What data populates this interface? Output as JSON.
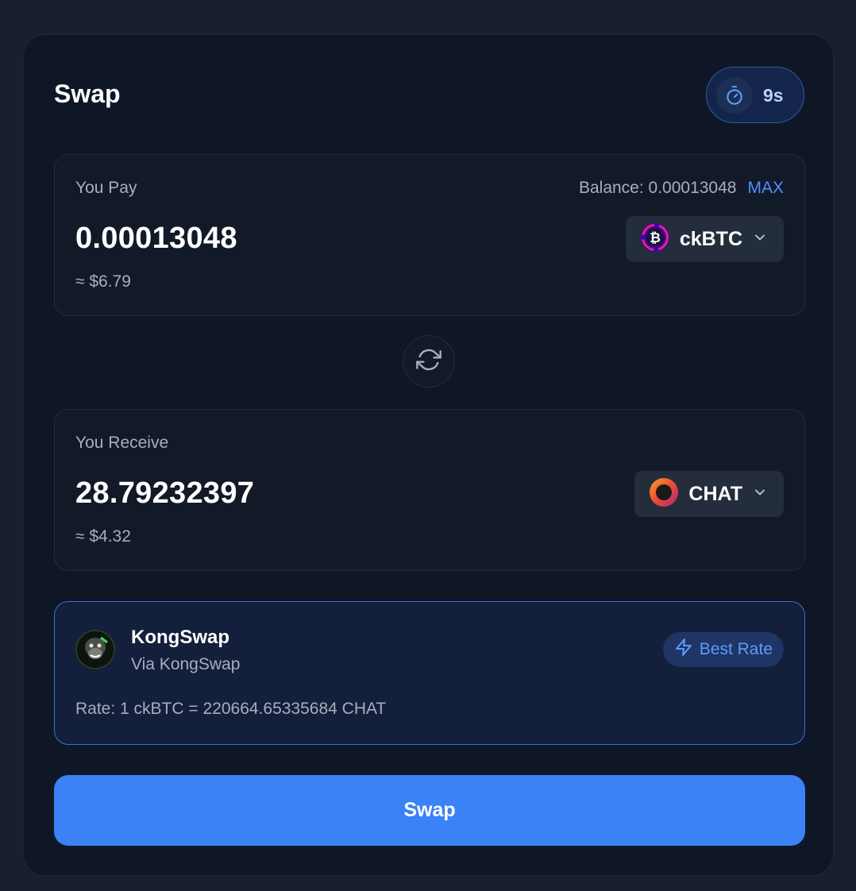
{
  "swap": {
    "title": "Swap",
    "timer": "9s",
    "submit_label": "Swap"
  },
  "pay": {
    "label": "You Pay",
    "balance_text": "Balance: 0.00013048",
    "max_label": "MAX",
    "amount": "0.00013048",
    "usd": "≈ $6.79",
    "token": "ckBTC",
    "token_icon": "ckbtc-token-icon"
  },
  "receive": {
    "label": "You Receive",
    "amount": "28.79232397",
    "usd": "≈ $4.32",
    "token": "CHAT",
    "token_icon": "chat-token-icon"
  },
  "route": {
    "name": "KongSwap",
    "via": "Via KongSwap",
    "badge": "Best Rate",
    "rate": "Rate: 1 ckBTC = 220664.65335684 CHAT"
  },
  "colors": {
    "accent": "#3b82f6",
    "link": "#4f90ff",
    "background": "#0f1726"
  }
}
